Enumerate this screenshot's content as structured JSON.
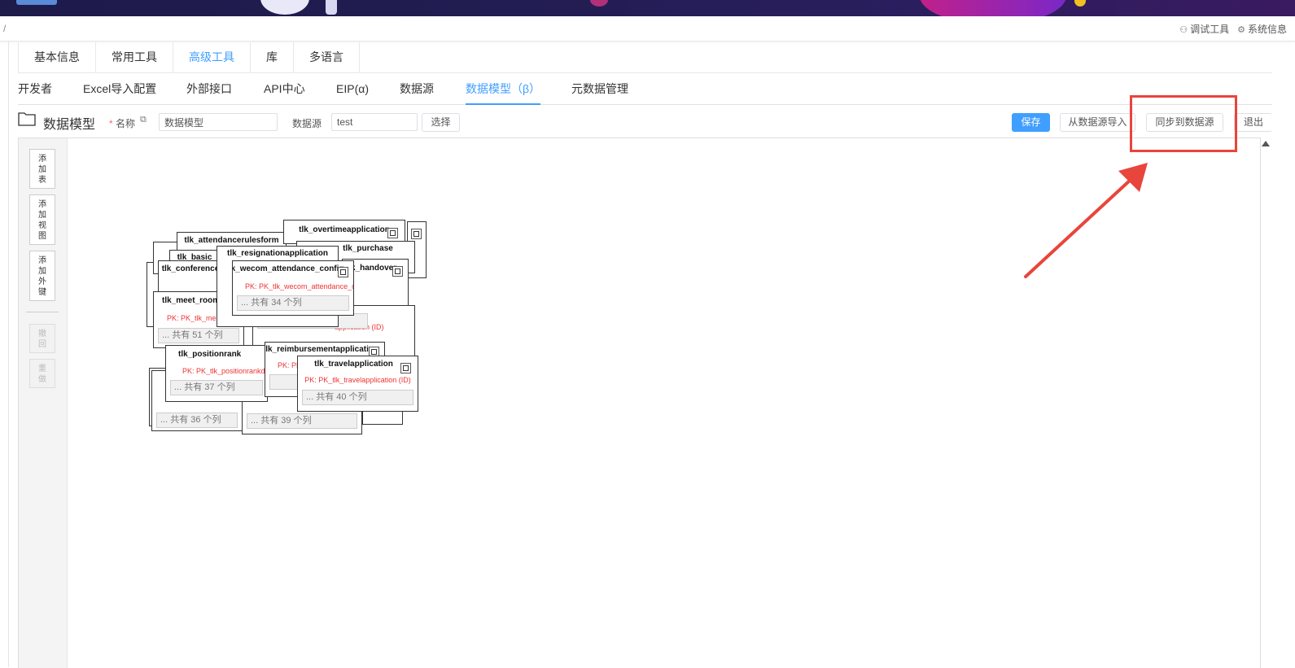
{
  "topbar": {
    "breadcrumb": "/",
    "debug_tools": "调试工具",
    "system_info": "系统信息"
  },
  "tabs_main": [
    "基本信息",
    "常用工具",
    "高级工具",
    "库",
    "多语言"
  ],
  "tabs_main_active": "高级工具",
  "tabs_sub": [
    "开发者",
    "Excel导入配置",
    "外部接口",
    "API中心",
    "EIP(α)",
    "数据源",
    "数据模型（β）",
    "元数据管理"
  ],
  "tabs_sub_active": "数据模型（β）",
  "toolbar": {
    "title": "数据模型",
    "name_label": "名称",
    "name_value": "数据模型",
    "datasource_label": "数据源",
    "datasource_value": "test",
    "select_btn": "选择",
    "save_btn": "保存",
    "import_btn": "从数据源导入",
    "sync_btn": "同步到数据源",
    "exit_btn": "退出"
  },
  "side": {
    "add_table": "添加表",
    "add_view": "添加视图",
    "add_fk": "添加外键",
    "undo": "撤回",
    "redo": "重做"
  },
  "tables": [
    {
      "name": "tlk_overtimeapplication",
      "pk": "",
      "cols": ""
    },
    {
      "name": "tlk_attendancerulesform",
      "pk": "",
      "cols": ""
    },
    {
      "name": "tlk_purchase",
      "pk": "",
      "cols": ""
    },
    {
      "name": "tlk_resignationapplication",
      "pk": "",
      "cols": ""
    },
    {
      "name": "tlk_basic",
      "pk": "",
      "cols": ""
    },
    {
      "name": "tlk_conference",
      "pk": "",
      "cols": ""
    },
    {
      "name": "tlk_handover",
      "pk": "",
      "cols": ""
    },
    {
      "name": "tlk_wecom_attendance_config",
      "pk": "PK: PK_tlk_wecom_attendance_config (ID)",
      "cols": "... 共有 34 个列"
    },
    {
      "name": "tlk_meet_room",
      "pk": "PK: PK_tlk_meet_room (ID)",
      "cols": "... 共有 51 个列"
    },
    {
      "name": "tlk_positionrank",
      "pk": "PK: PK_tlk_positionrankdata (ID)",
      "cols": "... 共有 37 个列"
    },
    {
      "name": "tlk_reimbursementapplication",
      "pk": "PK: PK_tlk_reimbursementapplication (ID)",
      "cols": ""
    },
    {
      "name": "tlk_travelapplication",
      "pk": "PK: PK_tlk_travelapplication (ID)",
      "cols": "... 共有 40 个列"
    }
  ],
  "misc_labels": {
    "cols_36": "... 共有 36 个列",
    "cols_39": "... 共有 39 个列",
    "cols_36b": "... 共有 36 个列",
    "app_id": "application (ID)"
  },
  "colors": {
    "accent": "#409eff",
    "highlight": "#e8453c",
    "pk": "#e33333"
  }
}
